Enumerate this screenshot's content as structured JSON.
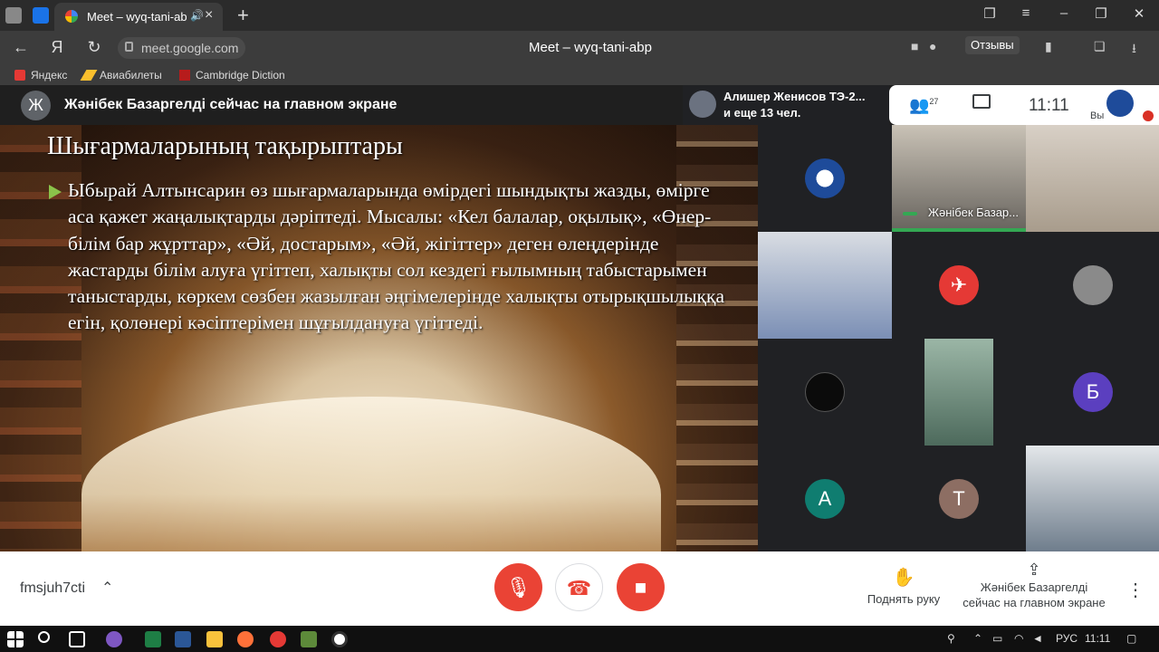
{
  "browser": {
    "tab_title": "Meet – wyq-tani-abp",
    "url": "meet.google.com",
    "page_title": "Meet – wyq-tani-abp",
    "feedback_label": "Отзывы",
    "bookmarks": [
      "Яндекс",
      "Авиабилеты",
      "Cambridge Diction"
    ]
  },
  "meet": {
    "presenter_avatar": "Ж",
    "presenting_text": "Жәнібек Базаргелді сейчас на главном экране",
    "notification_line1": "Алишер Женисов ТЭ-2...",
    "notification_line2": "и еще 13 чел.",
    "people_count": "27",
    "time": "11:11",
    "self_label": "Вы"
  },
  "slide": {
    "title": "Шығармаларының тақырыптары",
    "body": "Ыбырай Алтынсарин өз шығармаларында өмірдегі шындықты жазды, өмірге аса қажет жаңалықтарды дәріптеді. Мысалы: «Кел балалар, оқылық», «Өнер-білім бар жұрттар», «Әй, достарым», «Әй, жігіттер» деген өлеңдерінде жастарды білім алуға үгіттеп, халықты сол кездегі ғылымның табыстарымен таныстарды, көркем сөзбен жазылған әңгімелерінде халықты отырықшылыққа егін, қолөнері кәсіптерімен шұғылдануға үгіттеді."
  },
  "participants": {
    "speaker_name": "Жәнібек Базар...",
    "initial_b": "Б",
    "initial_a": "А",
    "initial_t": "Т"
  },
  "bottom": {
    "meeting_code": "fmsjuh7cti",
    "raise_hand": "Поднять руку",
    "presenter_line1": "Жәнібек Базаргелді",
    "presenter_line2": "сейчас на главном экране"
  },
  "taskbar": {
    "lang": "РУС",
    "time": "11:11"
  },
  "colors": {
    "end_call": "#ffffff",
    "mic_off": "#ea4335",
    "cam_off": "#ea4335",
    "avatar_b": "#5b3fbf",
    "avatar_a": "#0f7d70",
    "avatar_t": "#8d6e63"
  }
}
